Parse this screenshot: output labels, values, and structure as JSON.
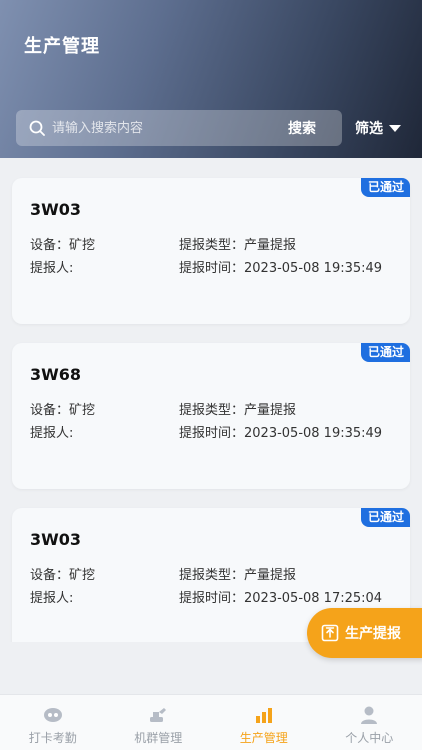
{
  "header": {
    "title": "生产管理"
  },
  "search": {
    "placeholder": "请输入搜索内容",
    "button_label": "搜索"
  },
  "filter": {
    "label": "筛选"
  },
  "cards": [
    {
      "code": "3W03",
      "status": "已通过",
      "device": "设备：矿挖",
      "report_type": "提报类型：产量提报",
      "reporter": "提报人:",
      "report_time": "提报时间：2023-05-08 19:35:49"
    },
    {
      "code": "3W68",
      "status": "已通过",
      "device": "设备：矿挖",
      "report_type": "提报类型：产量提报",
      "reporter": "提报人:",
      "report_time": "提报时间：2023-05-08 19:35:49"
    },
    {
      "code": "3W03",
      "status": "已通过",
      "device": "设备：矿挖",
      "report_type": "提报类型：产量提报",
      "reporter": "提报人:",
      "report_time": "提报时间：2023-05-08 17:25:04"
    }
  ],
  "fab": {
    "label": "生产提报"
  },
  "tabs": [
    {
      "label": "打卡考勤"
    },
    {
      "label": "机群管理"
    },
    {
      "label": "生产管理"
    },
    {
      "label": "个人中心"
    }
  ],
  "colors": {
    "accent": "#f5a31a",
    "badge": "#1f6fe0",
    "tab_inactive": "#9aa0a8"
  }
}
